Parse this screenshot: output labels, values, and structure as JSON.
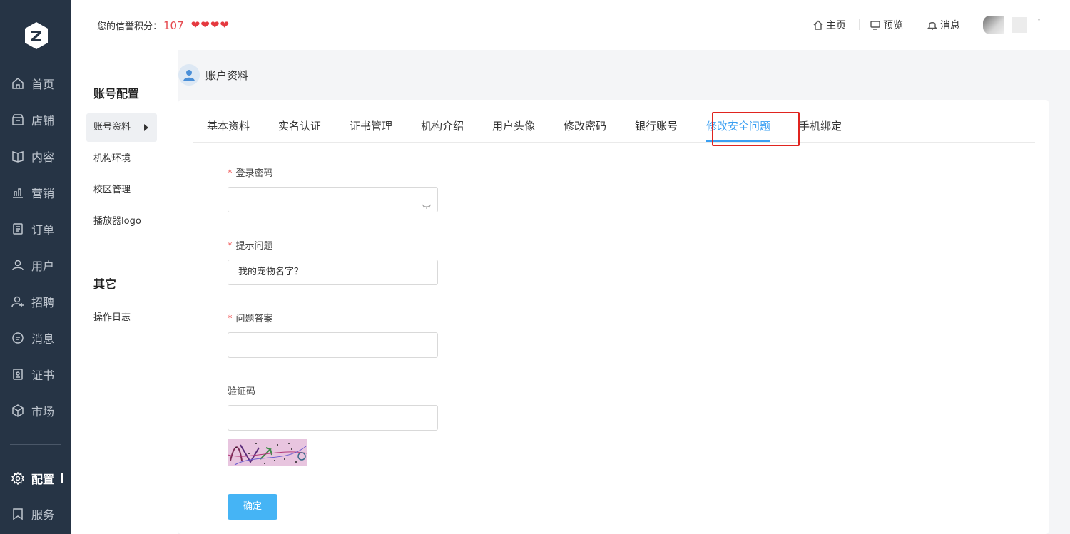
{
  "sidebar": {
    "items": [
      {
        "label": "首页",
        "icon": "home-icon"
      },
      {
        "label": "店铺",
        "icon": "store-icon"
      },
      {
        "label": "内容",
        "icon": "book-icon"
      },
      {
        "label": "营销",
        "icon": "bar-chart-icon"
      },
      {
        "label": "订单",
        "icon": "document-icon"
      },
      {
        "label": "用户",
        "icon": "user-icon"
      },
      {
        "label": "招聘",
        "icon": "user-add-icon"
      },
      {
        "label": "消息",
        "icon": "chat-icon"
      },
      {
        "label": "证书",
        "icon": "certificate-icon"
      },
      {
        "label": "市场",
        "icon": "cube-icon"
      },
      {
        "label": "配置",
        "icon": "gear-icon"
      },
      {
        "label": "服务",
        "icon": "bookmark-icon"
      }
    ]
  },
  "header": {
    "credit_label": "您的信誉积分：",
    "credit_score": "107",
    "hearts": "4",
    "nav": {
      "home": "主页",
      "preview": "预览",
      "messages": "消息"
    }
  },
  "submenu": {
    "section1_title": "账号配置",
    "section1_items": [
      "账号资料",
      "机构环境",
      "校区管理",
      "播放器logo"
    ],
    "section2_title": "其它",
    "section2_items": [
      "操作日志"
    ]
  },
  "page": {
    "title": "账户资料"
  },
  "tabs": [
    "基本资料",
    "实名认证",
    "证书管理",
    "机构介绍",
    "用户头像",
    "修改密码",
    "银行账号",
    "修改安全问题",
    "手机绑定"
  ],
  "active_tab": "修改安全问题",
  "form": {
    "required_mark": "*",
    "login_password_label": "登录密码",
    "login_password_value": "",
    "question_label": "提示问题",
    "question_value": "我的宠物名字？",
    "answer_label": "问题答案",
    "answer_value": "",
    "captcha_label": "验证码",
    "captcha_value": "",
    "submit_label": "确定"
  },
  "colors": {
    "sidebar_bg": "#263445",
    "accent": "#3a9ff2",
    "button": "#45b4f5",
    "highlight": "#e0241f",
    "score": "#e5494f"
  }
}
